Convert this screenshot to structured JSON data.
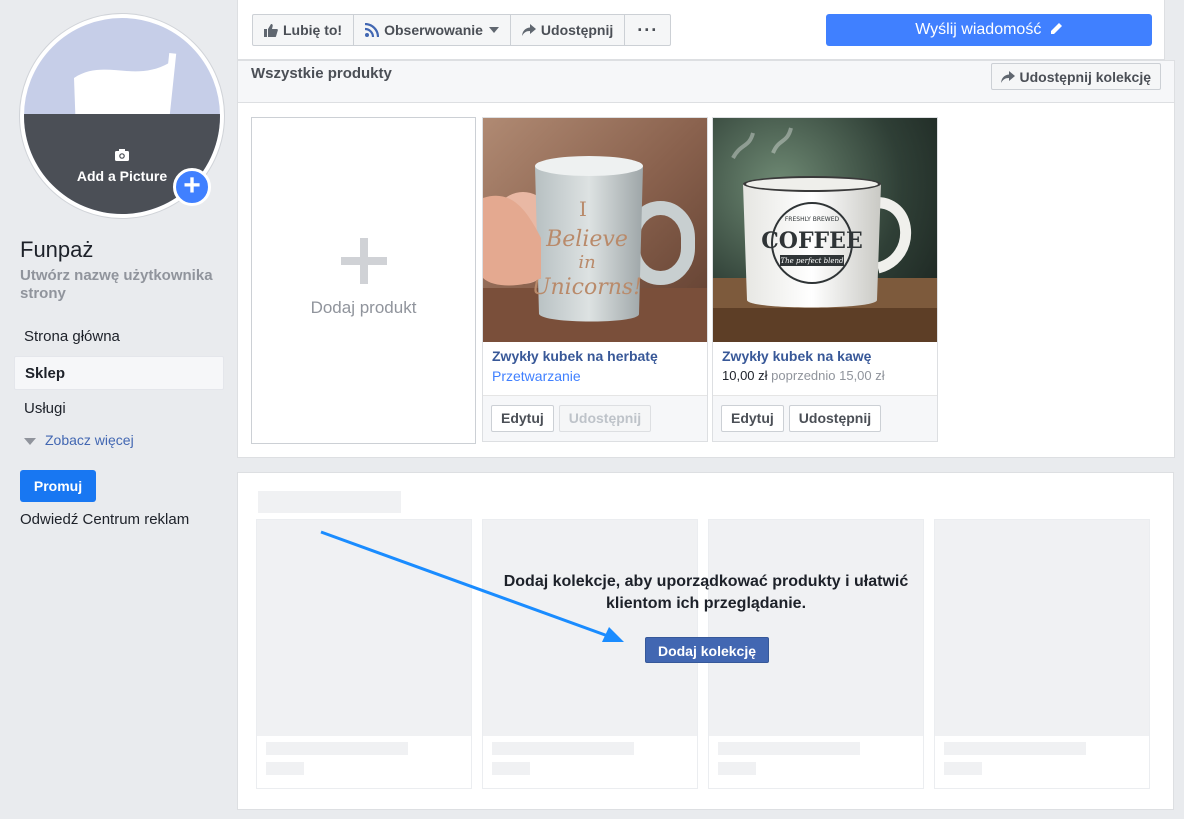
{
  "sidebar": {
    "avatar_label": "Add a Picture",
    "page_name": "Funpaż",
    "username_prompt": "Utwórz nazwę użytkownika strony",
    "nav": [
      {
        "label": "Strona główna",
        "active": false
      },
      {
        "label": "Sklep",
        "active": true
      },
      {
        "label": "Usługi",
        "active": false
      }
    ],
    "see_more": "Zobacz więcej",
    "promote_button": "Promuj",
    "ad_center_link": "Odwiedź Centrum reklam"
  },
  "toolbar": {
    "like": "Lubię to!",
    "follow": "Obserwowanie",
    "share": "Udostępnij",
    "more": "···",
    "send_message": "Wyślij wiadomość"
  },
  "products": {
    "title": "Wszystkie produkty",
    "share_collection": "Udostępnij kolekcję",
    "add_product": "Dodaj produkt",
    "items": [
      {
        "name": "Zwykły kubek na herbatę",
        "status": "Przetwarzanie",
        "edit": "Edytuj",
        "share": "Udostępnij",
        "share_enabled": false,
        "mug_text": [
          "I",
          "Believe",
          "in",
          "Unicorns!"
        ]
      },
      {
        "name": "Zwykły kubek na kawę",
        "price": "10,00 zł",
        "old_price": "poprzednio 15,00 zł",
        "edit": "Edytuj",
        "share": "Udostępnij",
        "share_enabled": true,
        "mug_text": [
          "FRESHLY BREWED",
          "COFFEE",
          "The perfect blend"
        ]
      }
    ]
  },
  "collections": {
    "prompt": "Dodaj kolekcje, aby uporządkować produkty i ułatwić klientom ich przeglądanie.",
    "add_button": "Dodaj kolekcję",
    "placeholder_price_symbol": "$"
  },
  "colors": {
    "primary_blue": "#4080ff",
    "link_blue": "#385898",
    "annotation_arrow": "#1a8cff",
    "page_background": "#e9ebee"
  }
}
